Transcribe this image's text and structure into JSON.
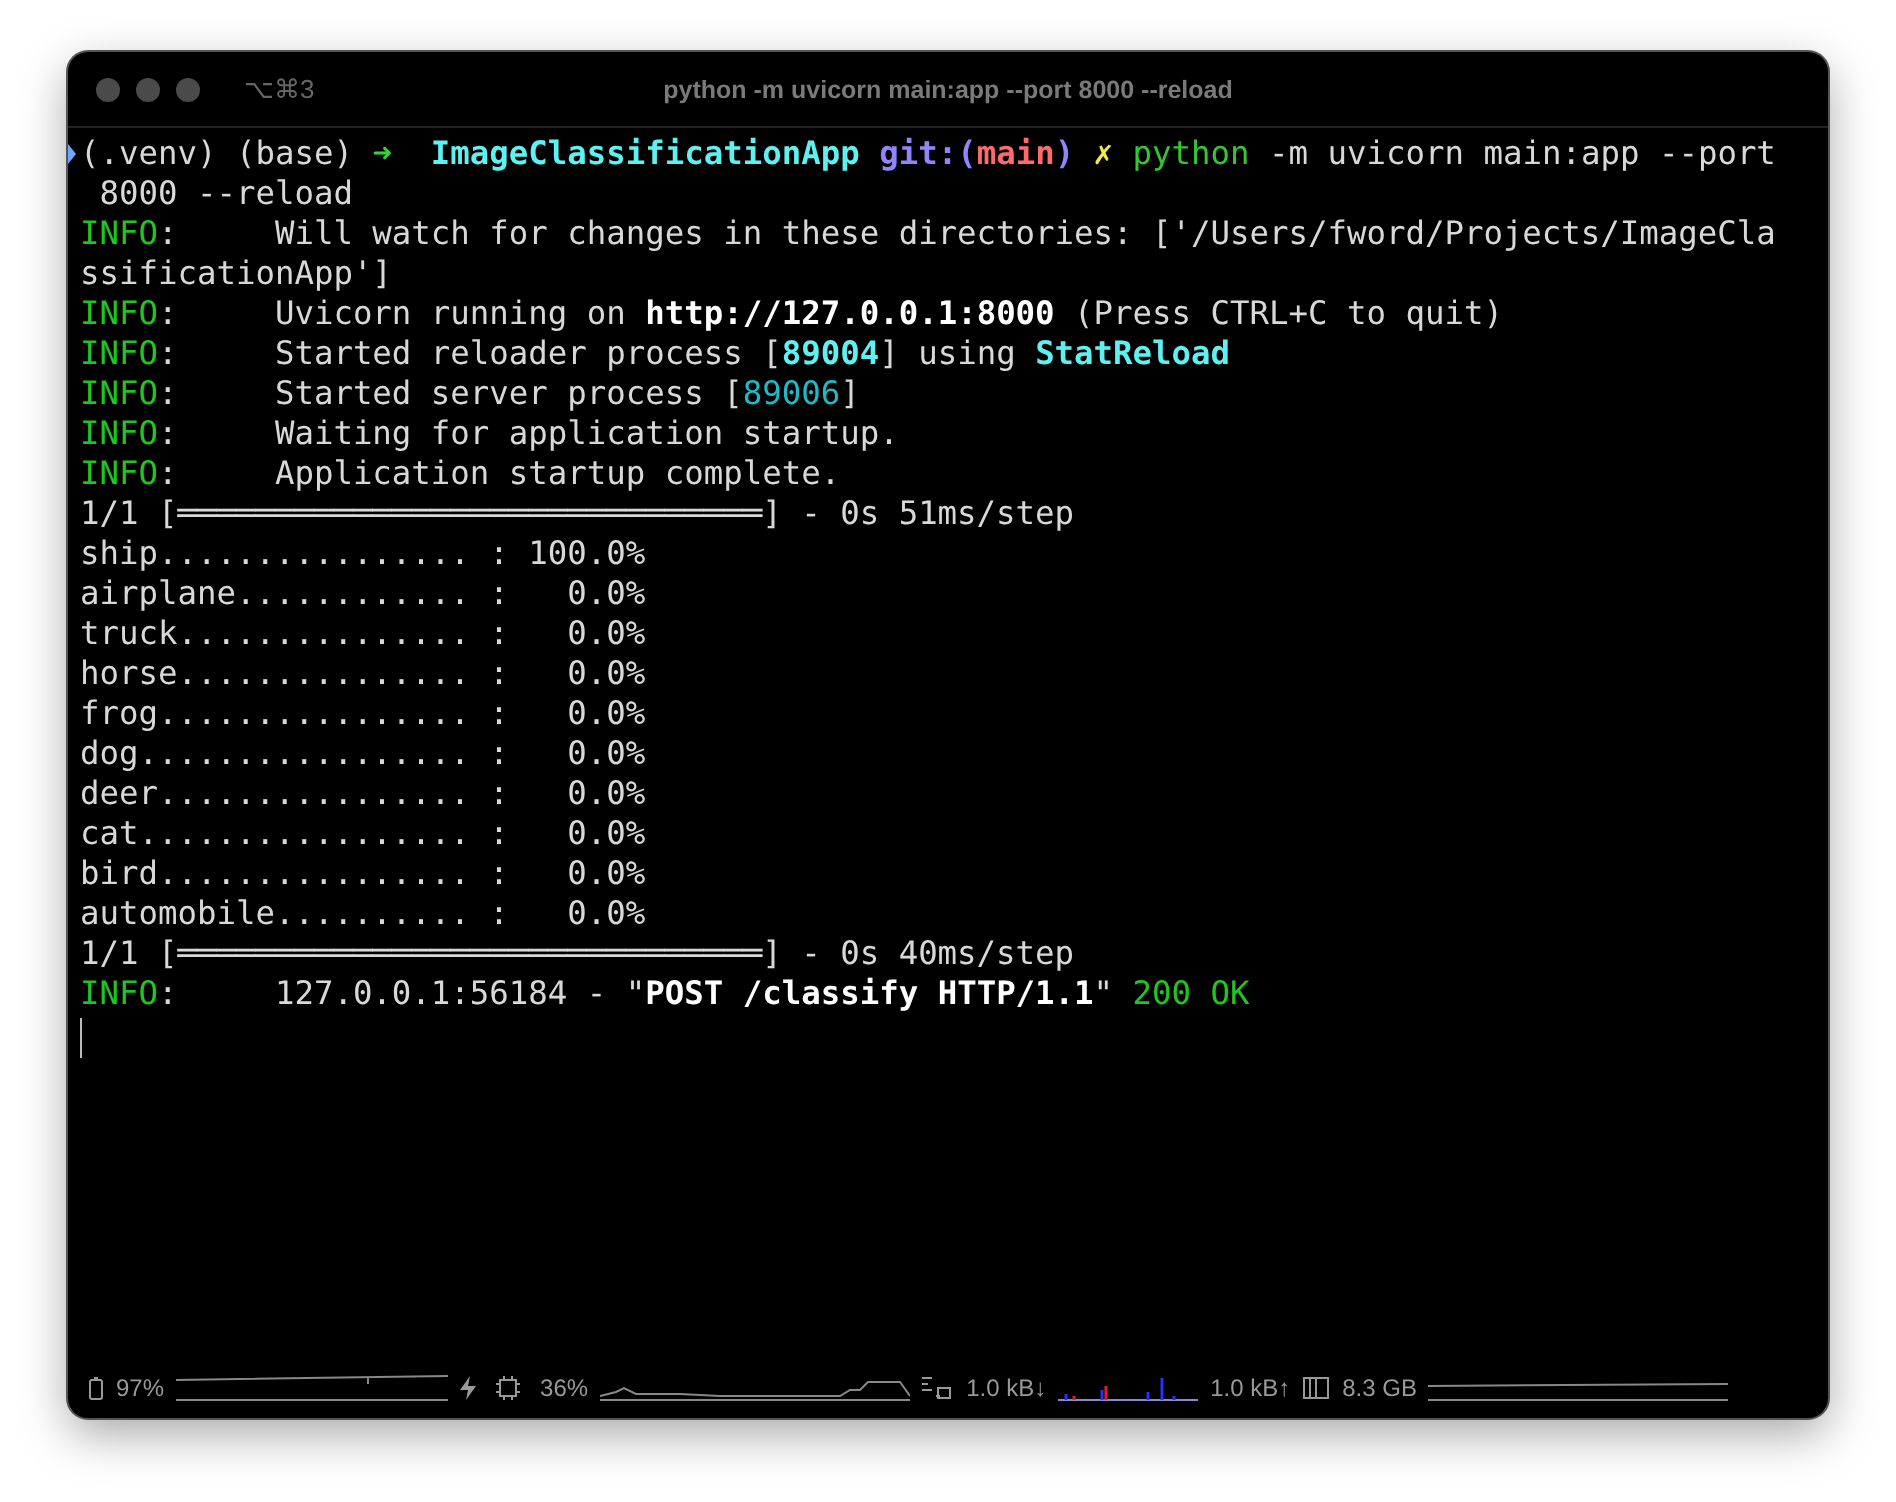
{
  "window": {
    "shortcut": "⌥⌘3",
    "title": "python -m uvicorn main:app --port 8000 --reload"
  },
  "lines": [
    {
      "segments": [
        {
          "kind": "plain",
          "text": "(.venv) (base) "
        },
        {
          "kind": "arrow",
          "text": "➜ "
        },
        {
          "kind": "dir",
          "text": " ImageClassificationApp"
        },
        {
          "kind": "git",
          "text": " git:("
        },
        {
          "kind": "branch",
          "text": "main"
        },
        {
          "kind": "git",
          "text": ")"
        },
        {
          "kind": "dirty",
          "text": " ✗"
        },
        {
          "kind": "command",
          "text": " python"
        },
        {
          "kind": "plain",
          "text": " -m uvicorn main:app --port"
        }
      ]
    },
    {
      "segments": [
        {
          "kind": "plain",
          "text": " 8000 --reload"
        }
      ]
    },
    {
      "segments": [
        {
          "kind": "info",
          "text": "INFO"
        },
        {
          "kind": "plain",
          "text": ":     Will watch for changes in these directories: ['/Users/fword/Projects/ImageCla"
        }
      ]
    },
    {
      "segments": [
        {
          "kind": "plain",
          "text": "ssificationApp']"
        }
      ]
    },
    {
      "segments": [
        {
          "kind": "info",
          "text": "INFO"
        },
        {
          "kind": "plain",
          "text": ":     Uvicorn running on "
        },
        {
          "kind": "bold",
          "text": "http://127.0.0.1:8000"
        },
        {
          "kind": "plain",
          "text": " (Press CTRL+C to quit)"
        }
      ]
    },
    {
      "segments": [
        {
          "kind": "info",
          "text": "INFO"
        },
        {
          "kind": "plain",
          "text": ":     Started reloader process ["
        },
        {
          "kind": "accent",
          "text": "89004"
        },
        {
          "kind": "plain",
          "text": "] using "
        },
        {
          "kind": "accent",
          "text": "StatReload"
        }
      ]
    },
    {
      "segments": [
        {
          "kind": "info",
          "text": "INFO"
        },
        {
          "kind": "plain",
          "text": ":     Started server process ["
        },
        {
          "kind": "number",
          "text": "89006"
        },
        {
          "kind": "plain",
          "text": "]"
        }
      ]
    },
    {
      "segments": [
        {
          "kind": "info",
          "text": "INFO"
        },
        {
          "kind": "plain",
          "text": ":     Waiting for application startup."
        }
      ]
    },
    {
      "segments": [
        {
          "kind": "info",
          "text": "INFO"
        },
        {
          "kind": "plain",
          "text": ":     Application startup complete."
        }
      ]
    },
    {
      "segments": [
        {
          "kind": "plain",
          "text": "1/1 [══════════════════════════════] - 0s 51ms/step"
        }
      ]
    },
    {
      "segments": [
        {
          "kind": "plain",
          "text": "ship................ : 100.0%"
        }
      ]
    },
    {
      "segments": [
        {
          "kind": "plain",
          "text": "airplane............ :   0.0%"
        }
      ]
    },
    {
      "segments": [
        {
          "kind": "plain",
          "text": "truck............... :   0.0%"
        }
      ]
    },
    {
      "segments": [
        {
          "kind": "plain",
          "text": "horse............... :   0.0%"
        }
      ]
    },
    {
      "segments": [
        {
          "kind": "plain",
          "text": "frog................ :   0.0%"
        }
      ]
    },
    {
      "segments": [
        {
          "kind": "plain",
          "text": "dog................. :   0.0%"
        }
      ]
    },
    {
      "segments": [
        {
          "kind": "plain",
          "text": "deer................ :   0.0%"
        }
      ]
    },
    {
      "segments": [
        {
          "kind": "plain",
          "text": "cat................. :   0.0%"
        }
      ]
    },
    {
      "segments": [
        {
          "kind": "plain",
          "text": "bird................ :   0.0%"
        }
      ]
    },
    {
      "segments": [
        {
          "kind": "plain",
          "text": "automobile.......... :   0.0%"
        }
      ]
    },
    {
      "segments": [
        {
          "kind": "plain",
          "text": "1/1 [══════════════════════════════] - 0s 40ms/step"
        }
      ]
    },
    {
      "segments": [
        {
          "kind": "info",
          "text": "INFO"
        },
        {
          "kind": "plain",
          "text": ":     127.0.0.1:56184 - \""
        },
        {
          "kind": "bold",
          "text": "POST /classify HTTP/1.1"
        },
        {
          "kind": "plain",
          "text": "\" "
        },
        {
          "kind": "ok",
          "text": "200 OK"
        }
      ]
    }
  ],
  "status_bar": {
    "battery": "97%",
    "cpu": "36%",
    "download": "1.0 kB↓",
    "upload": "1.0 kB↑",
    "memory": "8.3 GB"
  }
}
